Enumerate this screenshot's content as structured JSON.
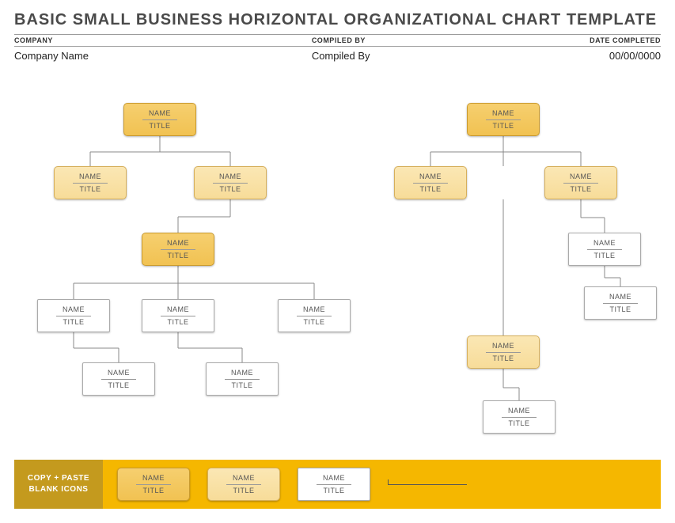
{
  "header": {
    "title": "BASIC SMALL BUSINESS HORIZONTAL ORGANIZATIONAL CHART TEMPLATE",
    "company_label": "COMPANY",
    "company_value": "Company Name",
    "compiled_label": "COMPILED BY",
    "compiled_value": "Compiled By",
    "date_label": "DATE COMPLETED",
    "date_value": "00/00/0000"
  },
  "placeholder": {
    "name": "NAME",
    "title": "TITLE"
  },
  "footer": {
    "label_line1": "COPY + PASTE",
    "label_line2": "BLANK ICONS"
  },
  "chart_data": {
    "type": "org_chart",
    "trees": [
      {
        "root": {
          "name": "NAME",
          "title": "TITLE",
          "style": "dark"
        },
        "children": [
          {
            "name": "NAME",
            "title": "TITLE",
            "style": "light"
          },
          {
            "name": "NAME",
            "title": "TITLE",
            "style": "light",
            "children": [
              {
                "name": "NAME",
                "title": "TITLE",
                "style": "dark",
                "center_child": true,
                "children": [
                  {
                    "name": "NAME",
                    "title": "TITLE",
                    "style": "white",
                    "children": [
                      {
                        "name": "NAME",
                        "title": "TITLE",
                        "style": "white"
                      }
                    ]
                  },
                  {
                    "name": "NAME",
                    "title": "TITLE",
                    "style": "white",
                    "children": [
                      {
                        "name": "NAME",
                        "title": "TITLE",
                        "style": "white"
                      }
                    ]
                  },
                  {
                    "name": "NAME",
                    "title": "TITLE",
                    "style": "white"
                  }
                ]
              }
            ]
          }
        ]
      },
      {
        "root": {
          "name": "NAME",
          "title": "TITLE",
          "style": "dark"
        },
        "children": [
          {
            "name": "NAME",
            "title": "TITLE",
            "style": "light"
          },
          {
            "name": "NAME",
            "title": "TITLE",
            "style": "white"
          },
          {
            "name": "NAME",
            "title": "TITLE",
            "style": "light",
            "children": [
              {
                "name": "NAME",
                "title": "TITLE",
                "style": "white",
                "children": [
                  {
                    "name": "NAME",
                    "title": "TITLE",
                    "style": "white"
                  },
                  {
                    "name": "NAME",
                    "title": "TITLE",
                    "style": "light",
                    "children": [
                      {
                        "name": "NAME",
                        "title": "TITLE",
                        "style": "white"
                      }
                    ]
                  }
                ]
              }
            ]
          }
        ]
      }
    ],
    "footer_swatches": [
      {
        "style": "dark"
      },
      {
        "style": "light"
      },
      {
        "style": "white"
      }
    ]
  }
}
